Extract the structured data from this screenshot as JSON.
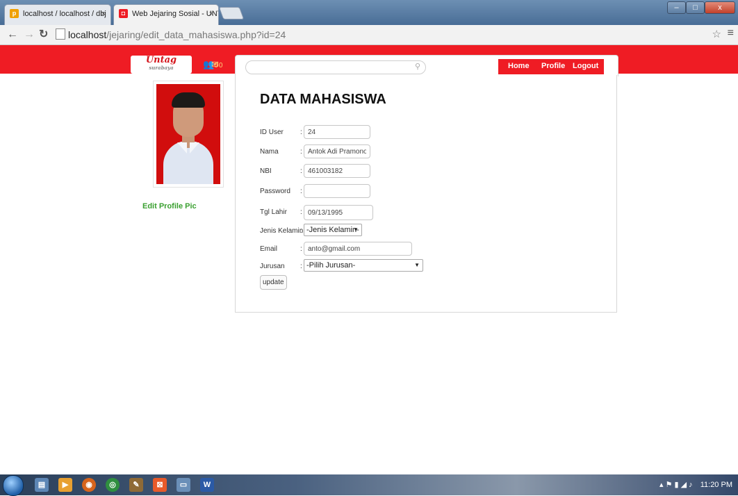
{
  "browser": {
    "tabs": [
      {
        "title": "localhost / localhost / dbj",
        "active": false
      },
      {
        "title": "Web Jejaring Sosial - UNT",
        "active": true
      }
    ],
    "tab_close": "×",
    "url_host": "localhost",
    "url_path": "/jejaring/edit_data_mahasiswa.php?id=24",
    "win_minimize": "–",
    "win_maximize": "□",
    "win_close": "x"
  },
  "header": {
    "logo_text": "Untag",
    "logo_sub": "surabaya",
    "friend_count": "0",
    "message_count": "0",
    "search_placeholder": "",
    "nav": [
      "Home",
      "Profile",
      "Logout"
    ]
  },
  "sidebar": {
    "edit_pic_label": "Edit Profile Pic"
  },
  "form": {
    "title": "DATA MAHASISWA",
    "colon": ":",
    "fields": [
      {
        "label": "ID User",
        "value": "24"
      },
      {
        "label": "Nama",
        "value": "Antok Adi Pramono"
      },
      {
        "label": "NBI",
        "value": "461003182"
      },
      {
        "label": "Password",
        "value": ""
      },
      {
        "label": "Tgl Lahir",
        "value": "09/13/1995"
      },
      {
        "label": "Jenis Kelamin",
        "value": "-Jenis Kelamin-"
      },
      {
        "label": "Email",
        "value": "anto@gmail.com"
      },
      {
        "label": "Jurusan",
        "value": "-Pilih Jurusan-"
      }
    ],
    "submit_label": "update"
  },
  "taskbar": {
    "clock": "11:20 PM"
  },
  "colors": {
    "brand_red": "#ef1c24",
    "link_green": "#3aa030"
  }
}
